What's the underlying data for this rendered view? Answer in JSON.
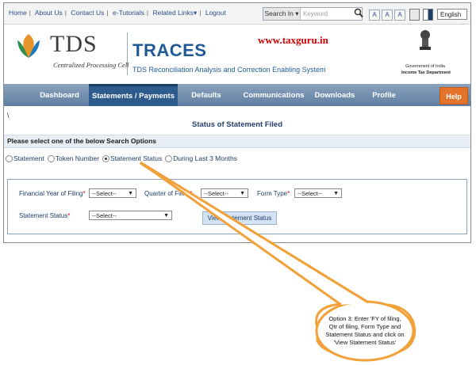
{
  "top_links": [
    "Home",
    "About Us",
    "Contact Us",
    "e-Tutorials",
    "Related Links",
    "Logout"
  ],
  "search": {
    "label": "Search In",
    "placeholder": "Keyword"
  },
  "font_buttons": [
    "A",
    "A",
    "A"
  ],
  "language": "English",
  "header": {
    "logo_text": "TDS",
    "logo_sub": "Centralized Processing Cell",
    "title": "TRACES",
    "subtitle": "TDS Reconciliation Analysis and Correction Enabling System",
    "watermark": "www.taxguru.in",
    "gov_line1": "Government of India",
    "gov_line2": "Income Tax Department"
  },
  "nav": {
    "items": [
      "Dashboard",
      "Statements / Payments",
      "Defaults",
      "Communications",
      "Downloads",
      "Profile"
    ],
    "help": "Help"
  },
  "page": {
    "backslash": "\\",
    "title": "Status of Statement Filed",
    "section": "Please select one of the below Search Options",
    "radios": [
      "Statement",
      "Token Number",
      "Statement Status",
      "During Last 3 Months"
    ],
    "selected_radio": "Statement Status"
  },
  "form": {
    "fy_label": "Financial Year of Filing",
    "quarter_label": "Quarter of Filing",
    "formtype_label": "Form Type",
    "status_label": "Statement Status",
    "required_mark": "*",
    "select_default": "--Select--",
    "view_button": "View Statement Status"
  },
  "callout": {
    "line1": "Option 3: Enter 'FY of filing,",
    "line2": "Qtr of filing, Form Type and",
    "line3": "Statement Status and click on",
    "line4": "'View Statement Status'"
  },
  "colors": {
    "nav": "#5f7fa3",
    "nav_active": "#2e5b8e",
    "help": "#e4742c",
    "callout": "#f2a13a",
    "traces": "#1f5a96"
  }
}
